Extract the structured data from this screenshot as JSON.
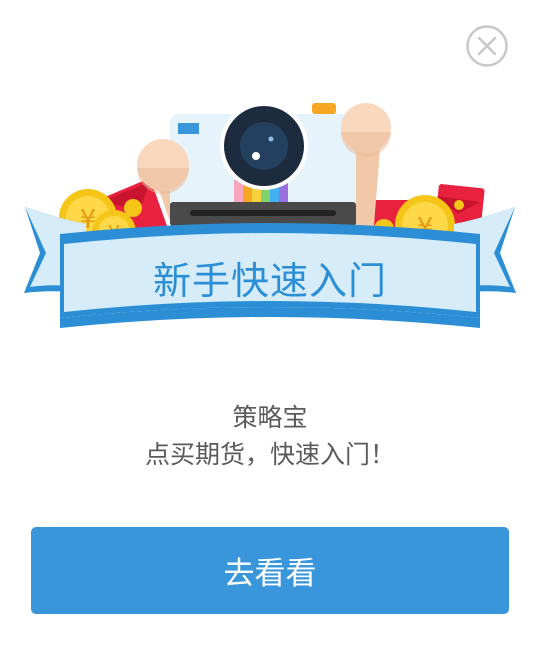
{
  "dialog": {
    "banner_title": "新手快速入门",
    "subtitle": "策略宝",
    "description": "点买期货，快速入门！",
    "cta_label": "去看看",
    "close_icon": "close-icon"
  },
  "colors": {
    "accent": "#3a96db",
    "ribbon_light": "#d6ecf9",
    "ribbon_dark": "#2c8fd6",
    "text": "#5a5a5a",
    "coin": "#f5c518",
    "red_envelope": "#e8213f"
  }
}
